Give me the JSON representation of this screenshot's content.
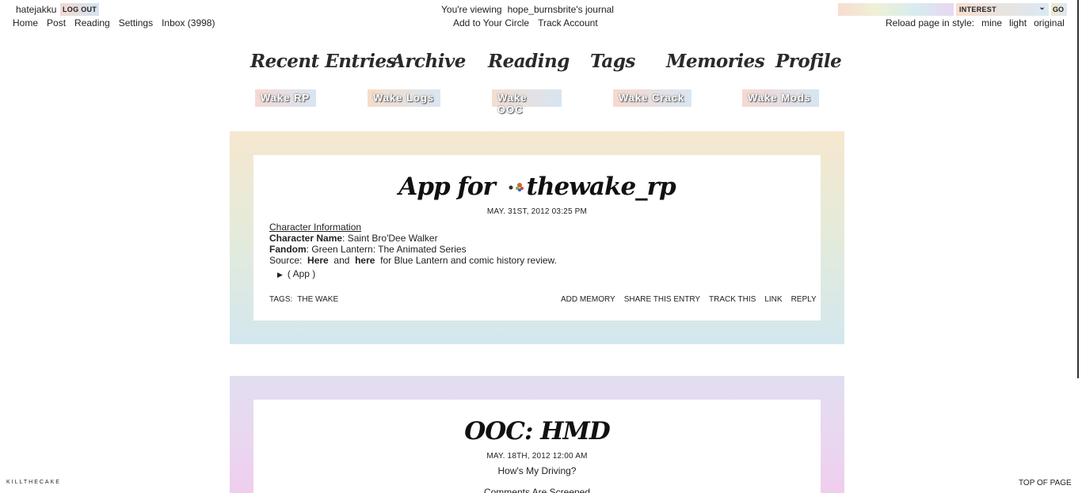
{
  "top": {
    "username": "hatejakku",
    "logout": "LOG OUT",
    "links": [
      "Home",
      "Post",
      "Reading",
      "Settings",
      "Inbox (3998)"
    ],
    "viewing_prefix": "You're viewing",
    "journal_name": "hope_burnsbrite",
    "viewing_suffix": "'s journal",
    "journal_links": [
      "Add to Your Circle",
      "Track Account"
    ],
    "search_value": "",
    "search_select": "INTEREST",
    "go": "GO",
    "style_label": "Reload page in style:",
    "styles": [
      "mine",
      "light",
      "original"
    ]
  },
  "nav": [
    "Recent Entries",
    "Archive",
    "Reading",
    "Tags",
    "Memories",
    "Profile"
  ],
  "subnav": [
    "Wake RP",
    "Wake Logs",
    "Wake OOC",
    "Wake Crack",
    "Wake Mods"
  ],
  "entry1": {
    "title_prefix": "App for",
    "community": "thewake_rp",
    "date": "MAY. 31ST, 2012 03:25 PM",
    "section": "Character Information",
    "name_label": "Character Name",
    "name_value": ": Saint Bro'Dee Walker",
    "fandom_label": "Fandom",
    "fandom_value": ": Green Lantern: The Animated Series",
    "source_label": "Source:",
    "source_link1": "Here",
    "source_and": "and",
    "source_link2": "here",
    "source_rest": "for Blue Lantern and comic history review.",
    "cut_label": "( App )",
    "tags_label": "TAGS:",
    "tag": "THE WAKE",
    "actions": [
      "ADD MEMORY",
      "SHARE THIS ENTRY",
      "TRACK THIS",
      "LINK",
      "REPLY"
    ]
  },
  "entry2": {
    "title": "OOC: HMD",
    "date": "MAY. 18TH, 2012 12:00 AM",
    "subtitle": "How's My Driving?",
    "line2": "Comments Are Screened"
  },
  "footer": {
    "left": "KILLTHECAKE",
    "right": "TOP OF PAGE"
  }
}
